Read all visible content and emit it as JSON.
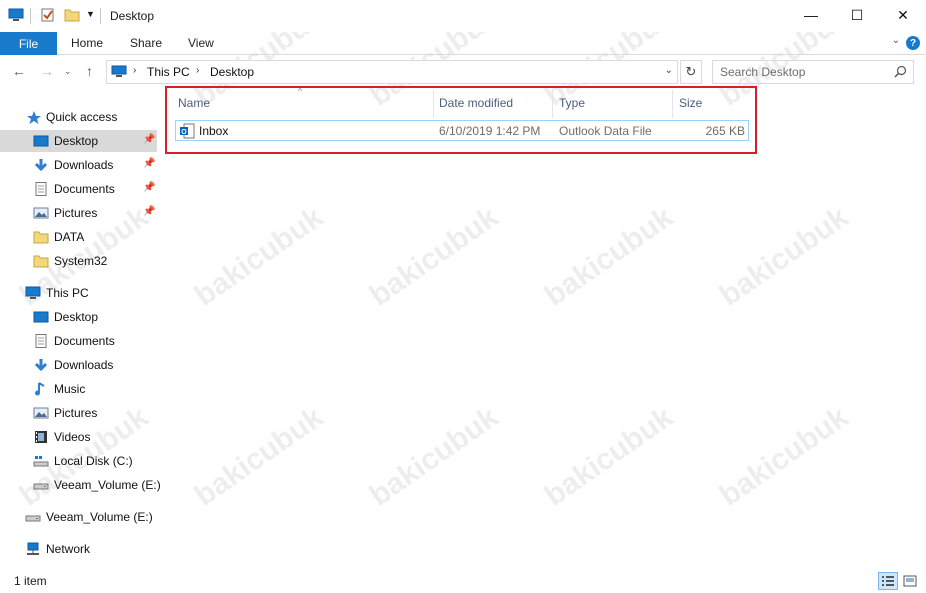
{
  "window": {
    "title": "Desktop",
    "minimize": "—",
    "maximize": "☐",
    "close": "✕"
  },
  "ribbon": {
    "file": "File",
    "tabs": [
      "Home",
      "Share",
      "View"
    ],
    "help": "?"
  },
  "address": {
    "crumbs": [
      "This PC",
      "Desktop"
    ],
    "search_placeholder": "Search Desktop"
  },
  "sidebar": {
    "quick_access": "Quick access",
    "quick_items": [
      {
        "label": "Desktop",
        "icon": "desktop-icon",
        "pinned": true
      },
      {
        "label": "Downloads",
        "icon": "downloads-icon",
        "pinned": true
      },
      {
        "label": "Documents",
        "icon": "documents-icon",
        "pinned": true
      },
      {
        "label": "Pictures",
        "icon": "pictures-icon",
        "pinned": true
      },
      {
        "label": "DATA",
        "icon": "folder-icon",
        "pinned": false
      },
      {
        "label": "System32",
        "icon": "folder-icon",
        "pinned": false
      }
    ],
    "this_pc": "This PC",
    "pc_items": [
      {
        "label": "Desktop",
        "icon": "desktop-icon"
      },
      {
        "label": "Documents",
        "icon": "documents-icon"
      },
      {
        "label": "Downloads",
        "icon": "downloads-icon"
      },
      {
        "label": "Music",
        "icon": "music-icon"
      },
      {
        "label": "Pictures",
        "icon": "pictures-icon"
      },
      {
        "label": "Videos",
        "icon": "videos-icon"
      },
      {
        "label": "Local Disk (C:)",
        "icon": "local-disk-icon"
      },
      {
        "label": "Veeam_Volume (E:)",
        "icon": "drive-icon"
      }
    ],
    "drive": "Veeam_Volume (E:)",
    "network": "Network"
  },
  "columns": {
    "name": "Name",
    "date": "Date modified",
    "type": "Type",
    "size": "Size"
  },
  "files": [
    {
      "name": "Inbox",
      "date": "6/10/2019 1:42 PM",
      "type": "Outlook Data File",
      "size": "265 KB"
    }
  ],
  "status": {
    "count": "1 item"
  },
  "watermark": "bakicubuk",
  "colors": {
    "accent": "#1979ca",
    "highlight": "#d3202a",
    "selected": "#d9d9d9"
  }
}
